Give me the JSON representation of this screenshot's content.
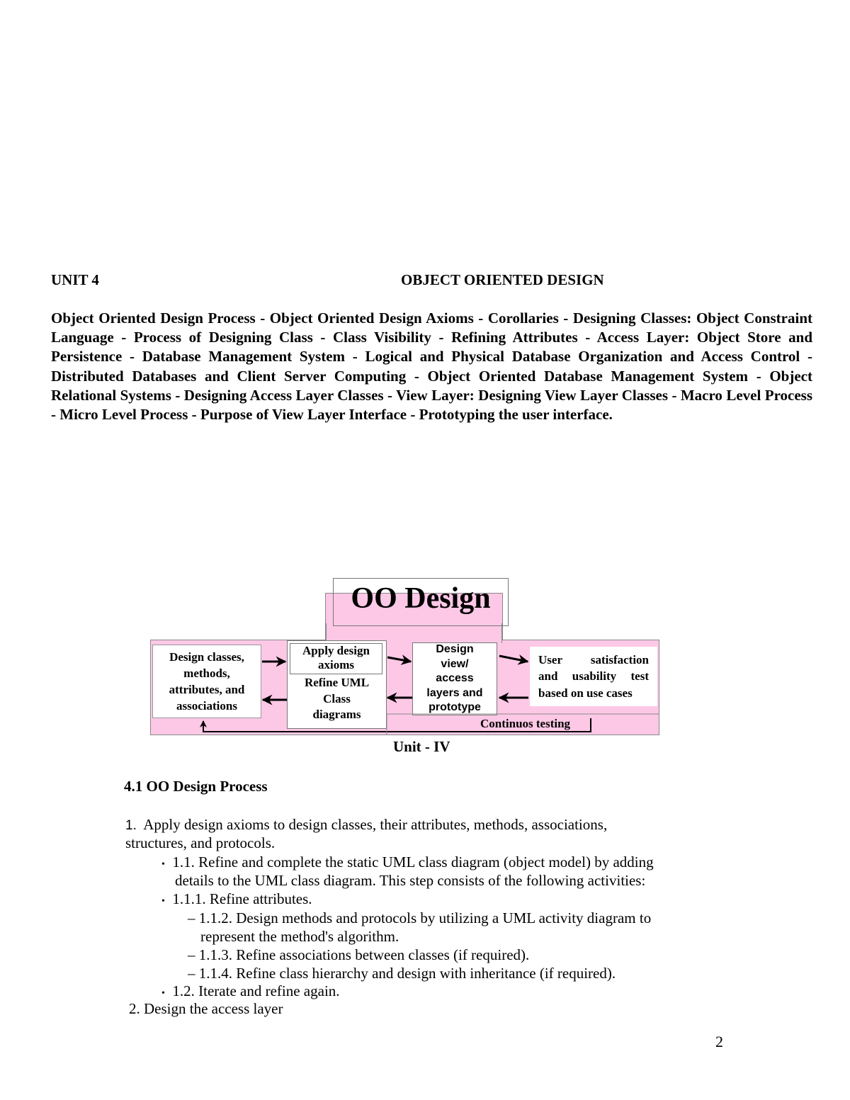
{
  "header": {
    "unit_label": "UNIT 4",
    "unit_title": "OBJECT ORIENTED DESIGN"
  },
  "syllabus": "Object Oriented Design Process - Object Oriented Design Axioms - Corollaries - Designing Classes: Object Constraint Language - Process of Designing Class - Class Visibility - Refining Attributes - Access Layer: Object Store and Persistence - Database Management System - Logical and Physical Database Organization and Access Control - Distributed Databases and Client Server Computing - Object Oriented Database Management System - Object Relational Systems - Designing Access Layer Classes - View Layer: Designing View Layer Classes - Macro Level Process - Micro Level Process - Purpose of View Layer Interface - Prototyping the user interface.",
  "diagram": {
    "title": "OO Design",
    "box_design_classes": [
      "Design classes,",
      "methods,",
      "attributes, and",
      "associations"
    ],
    "box_apply_axioms": [
      "Apply design",
      "axioms"
    ],
    "box_refine_uml": [
      "Refine UML",
      "Class",
      "diagrams"
    ],
    "box_design_view": [
      "Design",
      "view/",
      "access",
      "layers and",
      "prototype"
    ],
    "box_user_satisfaction": [
      "User satisfaction",
      "and usability test",
      "based on use cases"
    ],
    "continuous_testing_label": "Continuos testing",
    "caption": "Unit - IV",
    "colors": {
      "background": "#fdc8e6",
      "box": "#ffffff",
      "border": "#888888"
    }
  },
  "section": {
    "heading": "4.1 OO Design Process",
    "items": [
      {
        "marker": "1.",
        "text": "Apply design axioms to design classes, their attributes, methods, associations,",
        "cont": "structures, and protocols."
      },
      {
        "marker": "•",
        "text": "1.1. Refine and complete the static UML class diagram (object model) by adding",
        "cont": "details to the UML class diagram. This step consists of the following activities:"
      },
      {
        "marker": "•",
        "text": "1.1.1. Refine attributes."
      },
      {
        "marker": "–",
        "text": "1.1.2. Design methods and protocols by utilizing a UML activity diagram to",
        "cont": "represent the method's algorithm."
      },
      {
        "marker": "–",
        "text": "1.1.3. Refine associations between classes (if required)."
      },
      {
        "marker": "–",
        "text": "1.1.4. Refine class hierarchy and design with inheritance (if required)."
      },
      {
        "marker": "•",
        "text": "1.2. Iterate and refine again."
      },
      {
        "marker": "2.",
        "text": "Design the access layer"
      }
    ]
  },
  "page_number": "2"
}
